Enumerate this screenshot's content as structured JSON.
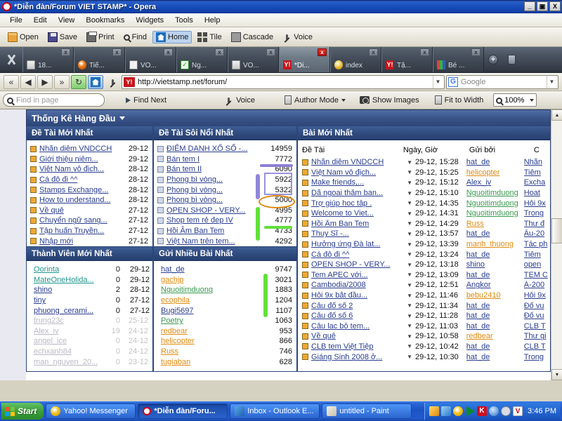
{
  "window": {
    "title": "*Diễn đàn/Forum VIET STAMP* - Opera",
    "minimize": "_",
    "maximize": "▣",
    "close": "X"
  },
  "menubar": {
    "items": [
      "File",
      "Edit",
      "View",
      "Bookmarks",
      "Widgets",
      "Tools",
      "Help"
    ]
  },
  "toolbar": {
    "buttons": [
      {
        "label": "Open",
        "icon": "folder-icon"
      },
      {
        "label": "Save",
        "icon": "save-icon"
      },
      {
        "label": "Print",
        "icon": "printer-icon"
      },
      {
        "label": "Find",
        "icon": "search-icon"
      },
      {
        "label": "Home",
        "icon": "home-icon"
      },
      {
        "label": "Tile",
        "icon": "tile-icon"
      },
      {
        "label": "Cascade",
        "icon": "cascade-icon"
      },
      {
        "label": "Voice",
        "icon": "microphone-icon"
      }
    ]
  },
  "tabs": {
    "wrench_icon": "wrench-icon",
    "new_tab_icon": "plus-icon",
    "trash_icon": "trash-icon",
    "close_label": "x",
    "items": [
      {
        "label": "18...",
        "icon": "document-icon",
        "selected": false
      },
      {
        "label": "Tiế...",
        "icon": "opera-icon",
        "selected": false
      },
      {
        "label": "VO...",
        "icon": "list-icon",
        "selected": false
      },
      {
        "label": "Ng...",
        "icon": "greenform-icon",
        "selected": false
      },
      {
        "label": "VO...",
        "icon": "document-icon",
        "selected": false
      },
      {
        "label": "*Di...",
        "icon": "yahoo-icon",
        "selected": true
      },
      {
        "label": "index",
        "icon": "coin-icon",
        "selected": false
      },
      {
        "label": "Tậ...",
        "icon": "yahoo-icon",
        "selected": false
      },
      {
        "label": "Bé ...",
        "icon": "chart-icon",
        "selected": false
      }
    ]
  },
  "addressbar": {
    "back_fast": "«",
    "back": "◀",
    "forward": "▶",
    "forward_fast": "»",
    "reload_icon": "reload-icon",
    "home_icon": "home-icon",
    "wand_icon": "wand-icon",
    "url": "http://vietstamp.net/forum/",
    "url_favicon": "Y!",
    "search_engine": "G",
    "search_placeholder": "Google"
  },
  "findbar": {
    "find_placeholder": "Find in page",
    "find_next": "Find Next",
    "voice": "Voice",
    "author_mode": "Author Mode",
    "show_images": "Show Images",
    "fit_to_width": "Fit to Width",
    "zoom": "100%"
  },
  "forum": {
    "top_title": "Thống Kê Hàng Đầu",
    "panels": {
      "latest_topics": {
        "title": "Đề Tài Mới Nhất",
        "rows": [
          {
            "title": "Nhãn diêm VNDCCH",
            "date": "29-12"
          },
          {
            "title": "Giới thiệu niêm...",
            "date": "29-12"
          },
          {
            "title": "Việt Nam vô địch...",
            "date": "28-12"
          },
          {
            "title": "Cá đô đi ^^",
            "date": "28-12"
          },
          {
            "title": "Stamps Exchange...",
            "date": "28-12"
          },
          {
            "title": "How to understand...",
            "date": "28-12"
          },
          {
            "title": "Về quê",
            "date": "27-12"
          },
          {
            "title": "Chuyển ngữ sang...",
            "date": "27-12"
          },
          {
            "title": "Tập huấn Truyền...",
            "date": "27-12"
          },
          {
            "title": "Nhập mới",
            "date": "27-12"
          }
        ]
      },
      "hottest_topics": {
        "title": "Đề Tài Sôi Nổi Nhất",
        "rows": [
          {
            "title": "ĐIỂM DANH XỔ SỐ -...",
            "count": "14959"
          },
          {
            "title": "Bán tem I",
            "count": "7772"
          },
          {
            "title": "Bán tem II",
            "count": "6090"
          },
          {
            "title": "Phong bì vòng...",
            "count": "5922"
          },
          {
            "title": "Phong bì vòng...",
            "count": "5322"
          },
          {
            "title": "Phong bì vòng...",
            "count": "5000"
          },
          {
            "title": "OPEN SHOP - VERY...",
            "count": "4995"
          },
          {
            "title": "Shop tem rẻ đep IV",
            "count": "4777"
          },
          {
            "title": "Hồi Âm Ban Tem",
            "count": "4733"
          },
          {
            "title": "Việt Nam trên tem...",
            "count": "4292"
          }
        ]
      },
      "newest_members": {
        "title": "Thành Viên Mới Nhất",
        "rows": [
          {
            "name": "Oorinta",
            "posts": "0",
            "date": "29-12",
            "color": "teal",
            "fade": false
          },
          {
            "name": "MateOneHolida...",
            "posts": "0",
            "date": "29-12",
            "color": "teal",
            "fade": false
          },
          {
            "name": "shino",
            "posts": "2",
            "date": "28-12",
            "color": "blue",
            "fade": false
          },
          {
            "name": "tiny",
            "posts": "0",
            "date": "27-12",
            "color": "blue",
            "fade": false
          },
          {
            "name": "phuong_cerami...",
            "posts": "0",
            "date": "27-12",
            "color": "blue",
            "fade": false
          },
          {
            "name": "trung23c",
            "posts": "0",
            "date": "25-12",
            "color": "blue",
            "fade": true
          },
          {
            "name": "Alex_iv",
            "posts": "19",
            "date": "24-12",
            "color": "blue",
            "fade": true
          },
          {
            "name": "angel_ice",
            "posts": "0",
            "date": "24-12",
            "color": "blue",
            "fade": true
          },
          {
            "name": "echxanh84",
            "posts": "0",
            "date": "24-12",
            "color": "blue",
            "fade": true
          },
          {
            "name": "man_nguyen_20...",
            "posts": "0",
            "date": "23-12",
            "color": "blue",
            "fade": true
          }
        ]
      },
      "top_posters": {
        "title": "Gửi Nhiều Bài Nhất",
        "rows": [
          {
            "name": "hat_de",
            "count": "9747",
            "color": "blue"
          },
          {
            "name": "gachjp",
            "count": "3021",
            "color": "orange"
          },
          {
            "name": "Nguoitimduong",
            "count": "1883",
            "color": "green"
          },
          {
            "name": "ecophila",
            "count": "1204",
            "color": "orange"
          },
          {
            "name": "Bugi5697",
            "count": "1107",
            "color": "blue"
          },
          {
            "name": "Poetry",
            "count": "1063",
            "color": "green"
          },
          {
            "name": "redbear",
            "count": "953",
            "color": "orange"
          },
          {
            "name": "helicopter",
            "count": "866",
            "color": "orange"
          },
          {
            "name": "Russ",
            "count": "746",
            "color": "orange"
          },
          {
            "name": "tugiaban",
            "count": "628",
            "color": "orange"
          }
        ]
      },
      "latest_posts": {
        "title": "Bài Mới Nhất",
        "columns": [
          "Đề Tài",
          "Ngày, Giờ",
          "Gửi bởi",
          "C"
        ],
        "rows": [
          {
            "topic": "Nhãn diêm VNDCCH",
            "datetime": "29-12, 15:28",
            "author": "hat_de",
            "author_color": "blue",
            "forum": "Nhãn "
          },
          {
            "topic": "Việt Nam vô địch...",
            "datetime": "29-12, 15:25",
            "author": "helicopter",
            "author_color": "orange",
            "forum": "Tiêm "
          },
          {
            "topic": "Make friends,...",
            "datetime": "29-12, 15:12",
            "author": "Alex_iv",
            "author_color": "blue",
            "forum": "Excha"
          },
          {
            "topic": "Dã ngoai thăm ban...",
            "datetime": "29-12, 15:10",
            "author": "Nguoitimduong",
            "author_color": "green",
            "forum": "Hoat "
          },
          {
            "topic": "Trợ giúp hoc tâp .",
            "datetime": "29-12, 14:35",
            "author": "Nguoitimduong",
            "author_color": "green",
            "forum": "Hôi 9x"
          },
          {
            "topic": "Welcome to Viet...",
            "datetime": "29-12, 14:31",
            "author": "Nguoitimduong",
            "author_color": "green",
            "forum": "Trong"
          },
          {
            "topic": "Hồi Âm Ban Tem",
            "datetime": "29-12, 14:29",
            "author": "Russ",
            "author_color": "orange",
            "forum": "Thư đ"
          },
          {
            "topic": "Thuy Sĩ -...",
            "datetime": "29-12, 13:57",
            "author": "hat_de",
            "author_color": "blue",
            "forum": "Âu-20"
          },
          {
            "topic": "Hưởng ứng Đà lat...",
            "datetime": "29-12, 13:39",
            "author": "manh_thuong",
            "author_color": "orange",
            "forum": "Tác ph"
          },
          {
            "topic": "Cá đô đi ^^",
            "datetime": "29-12, 13:24",
            "author": "hat_de",
            "author_color": "blue",
            "forum": "Tiêm "
          },
          {
            "topic": "OPEN SHOP - VERY...",
            "datetime": "29-12, 13:18",
            "author": "shino",
            "author_color": "blue",
            "forum": "open"
          },
          {
            "topic": "Tem APEC với...",
            "datetime": "29-12, 13:09",
            "author": "hat_de",
            "author_color": "blue",
            "forum": "TEM C"
          },
          {
            "topic": "Cambodia/2008",
            "datetime": "29-12, 12:51",
            "author": "Angkor",
            "author_color": "blue",
            "forum": "Á-200"
          },
          {
            "topic": "Hôi 9x bắt đầu...",
            "datetime": "29-12, 11:46",
            "author": "bebu2410",
            "author_color": "orange",
            "forum": "Hôi 9x"
          },
          {
            "topic": "Câu đố số 2",
            "datetime": "29-12, 11:34",
            "author": "hat_de",
            "author_color": "blue",
            "forum": "Đố vu"
          },
          {
            "topic": "Câu đố số 6",
            "datetime": "29-12, 11:28",
            "author": "hat_de",
            "author_color": "blue",
            "forum": "Đố vu"
          },
          {
            "topic": "Câu lac bô tem...",
            "datetime": "29-12, 11:03",
            "author": "hat_de",
            "author_color": "blue",
            "forum": "CLB T"
          },
          {
            "topic": "Về quê",
            "datetime": "29-12, 10:58",
            "author": "redbear",
            "author_color": "orange",
            "forum": "Thư gi"
          },
          {
            "topic": "CLB tem Việt Tiệp",
            "datetime": "29-12, 10:42",
            "author": "hat_de",
            "author_color": "blue",
            "forum": "CLB T"
          },
          {
            "topic": "Giáng Sinh 2008 ở...",
            "datetime": "29-12, 10:30",
            "author": "hat_de",
            "author_color": "blue",
            "forum": "Trong"
          }
        ]
      }
    }
  },
  "annotations": {
    "purple_underline": "#8b7fd4",
    "purple_box": "#9a90dd",
    "orange_ellipse": "#e08a14",
    "green_bar": "#62e03a"
  },
  "taskbar": {
    "start": "Start",
    "buttons": [
      {
        "label": "Yahoo! Messenger",
        "active": false,
        "icon": "yahoo-smiley-icon"
      },
      {
        "label": "*Diễn đàn/Foru...",
        "active": true,
        "icon": "opera-icon"
      },
      {
        "label": "Inbox - Outlook E...",
        "active": false,
        "icon": "outlook-icon"
      },
      {
        "label": "untitled - Paint",
        "active": false,
        "icon": "paint-icon"
      }
    ],
    "tray_icons": [
      "calendar-icon",
      "network-icon",
      "smiley-icon",
      "media-icon",
      "kaspersky-icon",
      "globe-icon",
      "clock-icon",
      "v-icon"
    ],
    "clock": "3:46 PM"
  }
}
